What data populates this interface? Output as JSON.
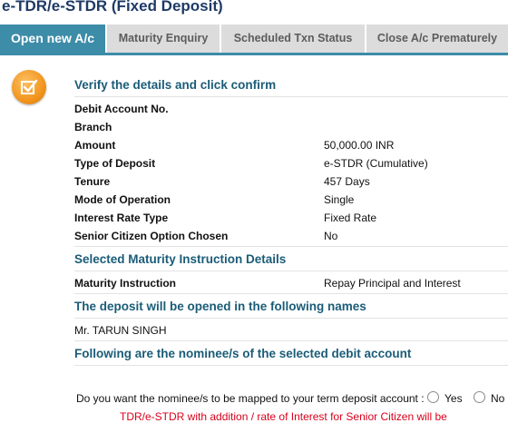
{
  "page_title": "e-TDR/e-STDR (Fixed Deposit)",
  "tabs": [
    {
      "label": "Open new A/c",
      "active": true
    },
    {
      "label": "Maturity Enquiry",
      "active": false
    },
    {
      "label": "Scheduled Txn Status",
      "active": false
    },
    {
      "label": "Close A/c Prematurely",
      "active": false
    }
  ],
  "verify": {
    "heading": "Verify the details and click confirm",
    "rows": [
      {
        "label": "Debit Account No.",
        "value": ""
      },
      {
        "label": "Branch",
        "value": ""
      },
      {
        "label": "Amount",
        "value": "50,000.00 INR"
      },
      {
        "label": "Type of Deposit",
        "value": "e-STDR (Cumulative)"
      },
      {
        "label": "Tenure",
        "value": "457 Days"
      },
      {
        "label": "Mode of Operation",
        "value": "Single"
      },
      {
        "label": "Interest Rate Type",
        "value": "Fixed Rate"
      },
      {
        "label": "Senior Citizen Option Chosen",
        "value": "No"
      }
    ]
  },
  "maturity": {
    "heading": "Selected Maturity Instruction Details",
    "label": "Maturity Instruction",
    "value": "Repay Principal and Interest"
  },
  "names": {
    "heading": "The deposit will be opened in the following names",
    "holder": "Mr. TARUN SINGH"
  },
  "nominee": {
    "heading": "Following are the nominee/s of the selected debit account",
    "question": "Do you want the nominee/s to be mapped to your term deposit account :",
    "options": [
      "Yes",
      "No"
    ]
  },
  "note": "TDR/e-STDR with addition / rate of Interest for Senior Citizen will be",
  "colors": {
    "accent": "#3d8ca8",
    "heading": "#1a5c78",
    "icon": "#f2951e",
    "note": "#d9001b"
  },
  "icons": {
    "section": "check-icon"
  }
}
